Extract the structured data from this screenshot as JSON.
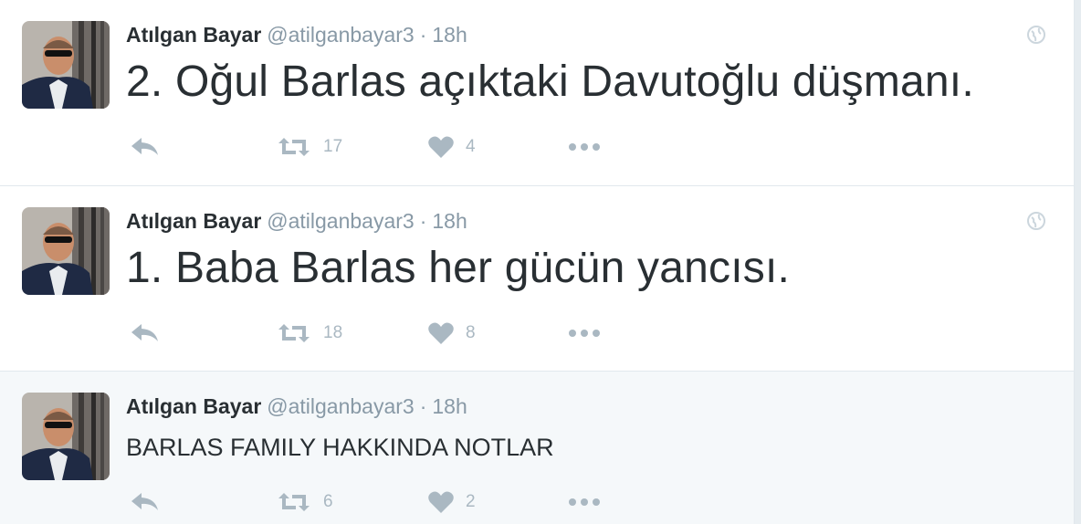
{
  "colors": {
    "name": "#292f33",
    "meta": "#8899a6",
    "action_icon": "#aab8c2",
    "border": "#e1e8ed",
    "highlight_bg": "#f5f8fa"
  },
  "icons": [
    "avatar-photo",
    "globe-icon",
    "reply-icon",
    "retweet-icon",
    "heart-icon",
    "more-icon"
  ],
  "tweets": [
    {
      "name": "Atılgan Bayar",
      "handle": "@atilganbayar3",
      "separator": "·",
      "time": "18h",
      "text": "2. Oğul Barlas açıktaki Davutoğlu düşmanı.",
      "retweets": "17",
      "likes": "4"
    },
    {
      "name": "Atılgan Bayar",
      "handle": "@atilganbayar3",
      "separator": "·",
      "time": "18h",
      "text": "1. Baba Barlas her gücün yancısı.",
      "retweets": "18",
      "likes": "8"
    },
    {
      "name": "Atılgan Bayar",
      "handle": "@atilganbayar3",
      "separator": "·",
      "time": "18h",
      "text": "BARLAS FAMILY HAKKINDA NOTLAR",
      "retweets": "6",
      "likes": "2"
    }
  ]
}
